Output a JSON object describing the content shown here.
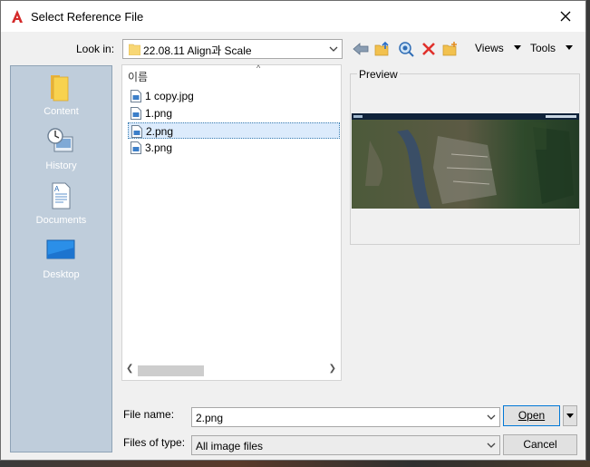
{
  "window": {
    "title": "Select Reference File",
    "close_icon": "close-icon",
    "app_icon": "autocad-icon"
  },
  "lookin": {
    "label": "Look in:",
    "value": "22.08.11 Align과 Scale"
  },
  "toolbar": {
    "icons": [
      "back-icon",
      "up-folder-icon",
      "search-web-icon",
      "delete-icon",
      "new-folder-icon"
    ],
    "views_label": "Views",
    "tools_label": "Tools"
  },
  "places": [
    {
      "label": "Content",
      "icon": "folder-icon"
    },
    {
      "label": "History",
      "icon": "history-icon"
    },
    {
      "label": "Documents",
      "icon": "documents-icon"
    },
    {
      "label": "Desktop",
      "icon": "desktop-icon"
    }
  ],
  "filelist": {
    "column_header": "이름",
    "files": [
      {
        "name": "1 copy.jpg",
        "selected": false
      },
      {
        "name": "1.png",
        "selected": false
      },
      {
        "name": "2.png",
        "selected": true
      },
      {
        "name": "3.png",
        "selected": false
      }
    ]
  },
  "preview": {
    "label": "Preview"
  },
  "filename": {
    "label": "File name:",
    "value": "2.png"
  },
  "filetype": {
    "label": "Files of type:",
    "value": "All image files"
  },
  "buttons": {
    "open": "Open",
    "cancel": "Cancel"
  },
  "colors": {
    "places_bg": "#bfcddb",
    "selection": "#dcebfc",
    "accent": "#0078d7"
  }
}
